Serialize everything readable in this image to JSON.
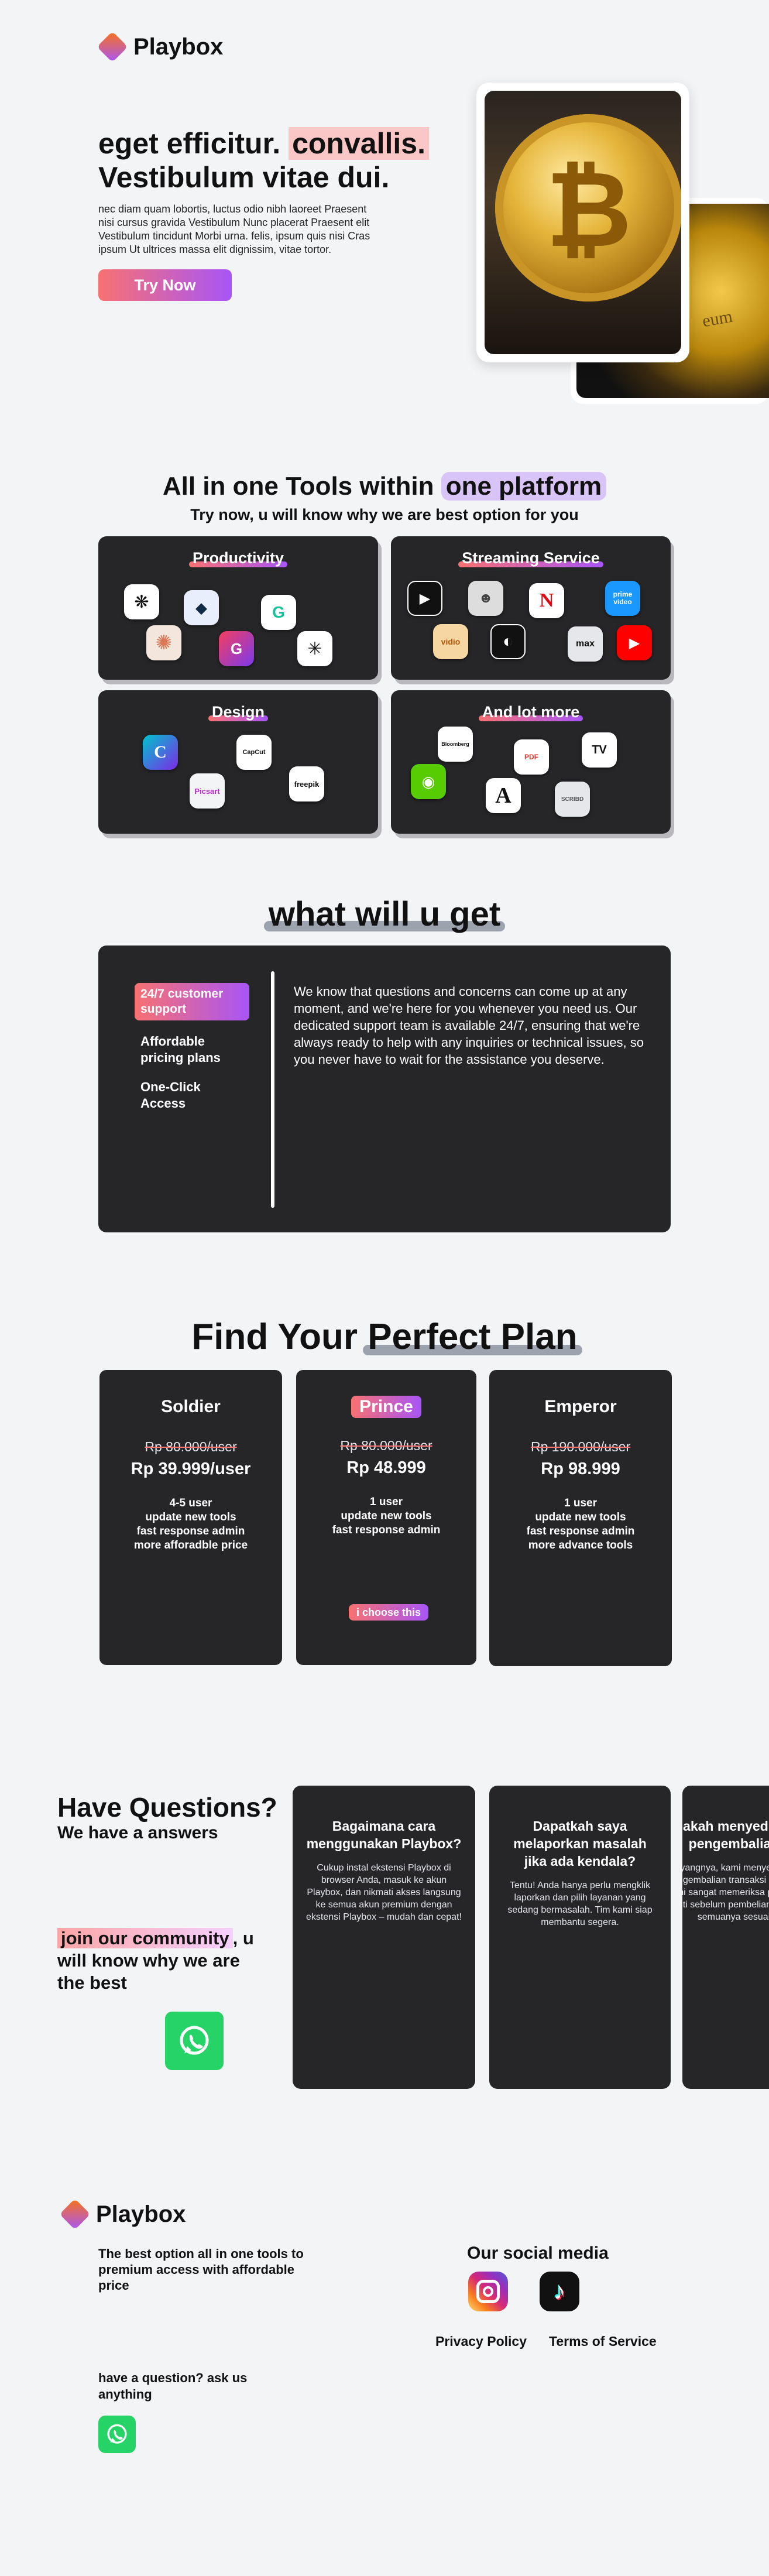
{
  "brand": {
    "name": "Playbox"
  },
  "hero": {
    "heading_a": "eget efficitur. ",
    "heading_b": "convallis.",
    "heading_c": "Vestibulum vitae dui.",
    "body": "nec diam quam lobortis, luctus odio nibh laoreet Praesent nisi cursus gravida Vestibulum Nunc placerat Praesent elit Vestibulum tincidunt Morbi urna. felis, ipsum quis nisi Cras ipsum Ut ultrices massa elit dignissim, vitae tortor.",
    "cta": "Try Now",
    "coin_text": "eum"
  },
  "tools": {
    "title_a": "All in one Tools within ",
    "title_b": "one platform",
    "subtitle": "Try now, u will know why we are best option for you",
    "cards": [
      {
        "title": "Productivity"
      },
      {
        "title": "Streaming Service"
      },
      {
        "title": "Design"
      },
      {
        "title": "And lot more"
      }
    ],
    "icons": {
      "chatgpt": "chatgpt-icon",
      "deepl": "deepl-icon",
      "grammarly": "grammarly-icon",
      "claude": "claude-icon",
      "gamma": "gamma-icon",
      "perplexity": "perplexity-icon",
      "appletv": "apple-tv-icon",
      "crunchy": "crunchyroll-icon",
      "netflix": "netflix-icon",
      "prime": "prime-video-icon",
      "vidio": "vidio-icon",
      "wetv": "wetv-icon",
      "max": "max-icon",
      "youtube": "youtube-icon",
      "canva": "canva-icon",
      "capcut": "capcut-icon",
      "picsart": "picsart-icon",
      "freepik": "freepik-icon",
      "bloomberg": "bloomberg-icon",
      "ilovepdf": "ilovepdf-icon",
      "tradingview": "tradingview-icon",
      "duolingo": "duolingo-icon",
      "academia": "academia-icon",
      "scribd": "scribd-icon"
    },
    "labels": {
      "prime": "prime video",
      "vidio": "vidio",
      "max": "max",
      "capcut": "CapCut",
      "picsart": "Picsart",
      "freepik": "freepik",
      "bloomberg": "Bloomberg",
      "ilovepdf": "PDF",
      "tradingview": "TV",
      "academia": "A",
      "scribd": "SCRIBD",
      "netflix": "N",
      "canva": "C",
      "gamma": "G",
      "grammarly": "G"
    }
  },
  "benefits": {
    "title": "what will u get",
    "tabs": [
      "24/7 customer support",
      "Affordable pricing plans",
      "One-Click Access"
    ],
    "text": "We know that questions and concerns can come up at any moment, and we're here for you whenever you need us. Our dedicated support team is available 24/7, ensuring that we're always ready to help with any inquiries or technical issues, so you never have to wait for the assistance you deserve."
  },
  "plans": {
    "title_a": "Find Your ",
    "title_b": "Perfect Plan",
    "items": [
      {
        "name": "Soldier",
        "old": "Rp 80.000/user",
        "price": "Rp 39.999/user",
        "features": [
          "4-5 user",
          "update new tools",
          "fast response admin",
          "more afforadble price"
        ]
      },
      {
        "name": "Prince",
        "old": "Rp 80.000/user",
        "price": "Rp 48.999",
        "features": [
          "1 user",
          "update new tools",
          "fast response admin"
        ],
        "cta": "i choose this"
      },
      {
        "name": "Emperor",
        "old": "Rp 190.000/user",
        "price": "Rp 98.999",
        "features": [
          "1 user",
          "update new tools",
          "fast response admin",
          "more advance tools"
        ]
      }
    ]
  },
  "questions": {
    "title": "Have Questions?",
    "subtitle": "We have a answers",
    "community_a": "join our community",
    "community_b": ", u will know why we are the best",
    "faqs": [
      {
        "q": "Bagaimana cara menggunakan Playbox?",
        "a": "Cukup instal ekstensi Playbox di browser Anda, masuk ke akun Playbox, dan nikmati akses langsung ke semua akun premium dengan ekstensi Playbox – mudah dan cepat!"
      },
      {
        "q": "Dapatkah saya melaporkan masalah jika ada kendala?",
        "a": "Tentu! Anda hanya perlu mengklik laporkan dan pilih layanan yang sedang bermasalah. Tim kami siap membantu segera."
      },
      {
        "q": "Apakah menyediakan pengembalian",
        "a": "Sayangnya, kami menyediakan pengembalian transaksi selesai. Kami sangat memeriksa pesanan teliti sebelum pembelian untuk semuanya sesuai"
      }
    ]
  },
  "footer": {
    "tagline": "The  best option all in one tools to premium access with affordable price",
    "ask": "have a question? ask us anything",
    "social_title": "Our social media",
    "links": [
      "Privacy Policy",
      "Terms of Service"
    ]
  },
  "colors": {
    "accent_from": "#f87171",
    "accent_to": "#a855f7",
    "card": "#262628",
    "whatsapp": "#25d366"
  }
}
